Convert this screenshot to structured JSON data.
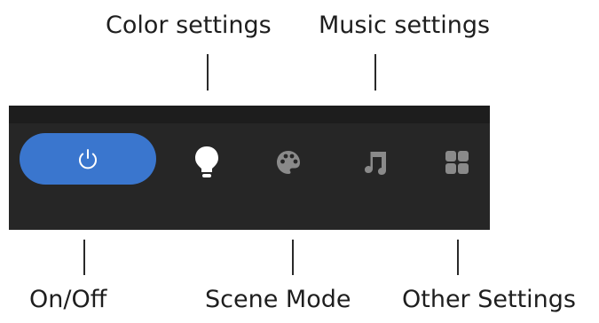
{
  "callouts": {
    "color_settings": "Color settings",
    "music_settings": "Music settings",
    "on_off": "On/Off",
    "scene_mode": "Scene Mode",
    "other_settings": "Other Settings"
  },
  "toolbar": {
    "background_color": "#262626",
    "power_button": {
      "icon": "power-icon",
      "color": "#3a76ce"
    },
    "items": [
      {
        "icon": "lightbulb-icon",
        "color": "#ffffff",
        "active": true
      },
      {
        "icon": "palette-icon",
        "color": "#8a8a8a",
        "active": false
      },
      {
        "icon": "music-note-icon",
        "color": "#8a8a8a",
        "active": false
      },
      {
        "icon": "grid-icon",
        "color": "#8a8a8a",
        "active": false
      }
    ]
  }
}
